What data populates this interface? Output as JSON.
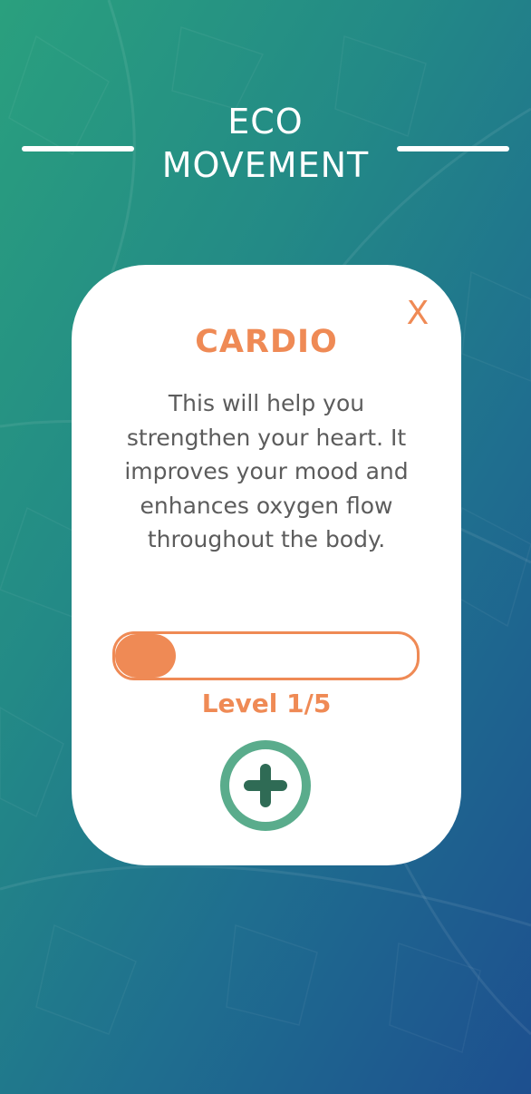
{
  "app": {
    "title_line1": "ECO",
    "title_line2": "MOVEMENT"
  },
  "card": {
    "close_label": "X",
    "title": "CARDIO",
    "description": "This will help you strengthen your heart. It improves your mood and enhances oxygen flow throughout the body.",
    "progress_fraction": 0.2,
    "level_label": "Level 1/5",
    "add_icon": "plus-circle-icon"
  },
  "colors": {
    "accent": "#ef8a55",
    "add_ring": "#5aac8c",
    "add_plus": "#2f6b55",
    "text": "#5c5c5c",
    "bg_start": "#2aa07e",
    "bg_end": "#1d4f8f"
  }
}
